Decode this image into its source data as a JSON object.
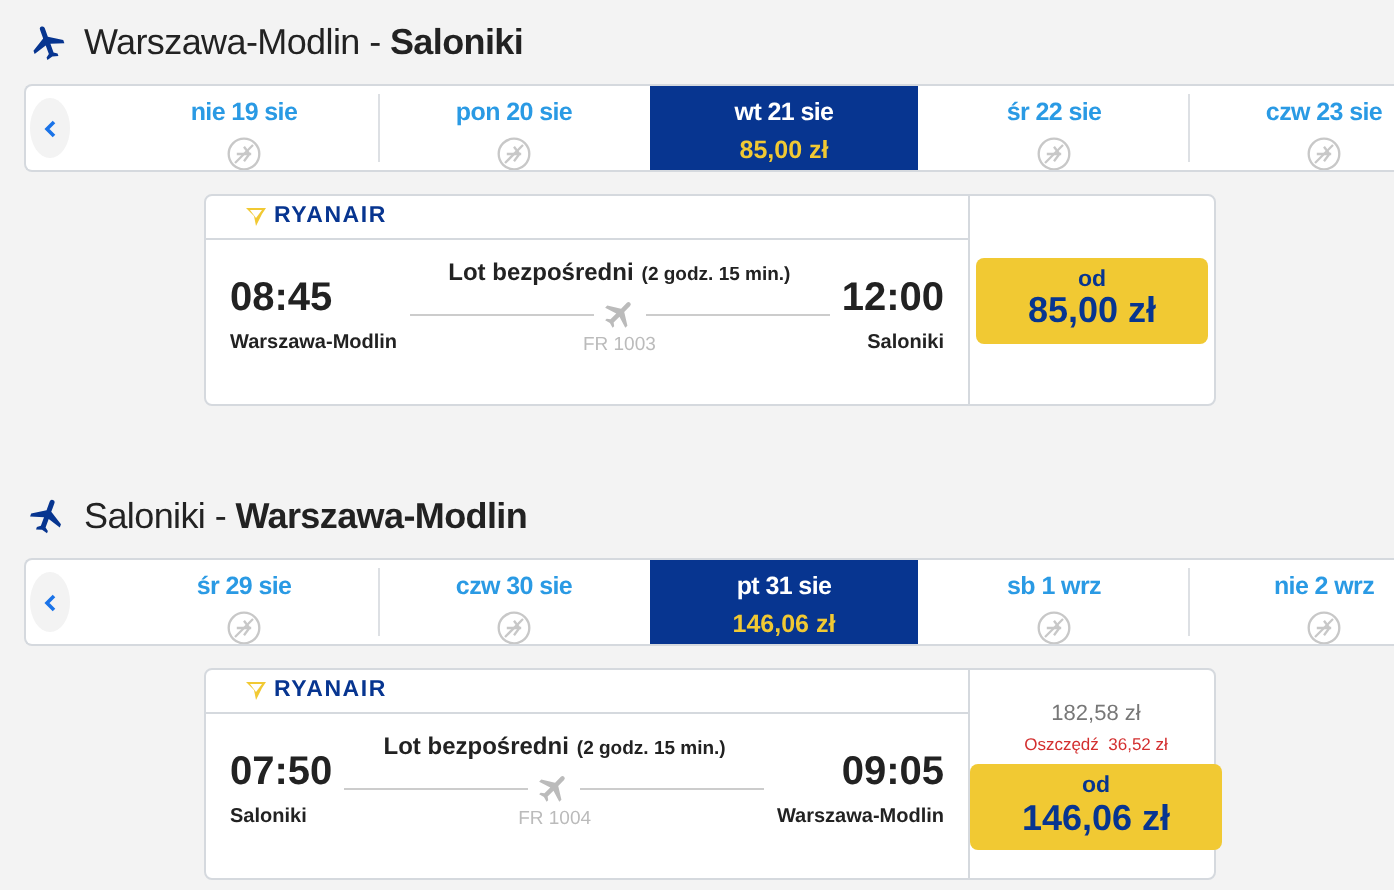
{
  "sections": [
    {
      "title": "Warszawa-Modlin - **Saloniki**",
      "days": [
        {
          "label": "nie 19 sie",
          "selected": false
        },
        {
          "label": "pon 20 sie",
          "selected": false
        },
        {
          "label": "wt 21 sie",
          "selected": true,
          "price": "85,00 zł"
        },
        {
          "label": "śr 22 sie",
          "selected": false
        },
        {
          "label": "czw 23 sie",
          "selected": false
        }
      ],
      "flight": {
        "airline": "RYANAIR",
        "type": "Lot bezpośredni",
        "duration": "(2 godz. 15 min.)",
        "depart_time": "08:45",
        "arrive_time": "12:00",
        "number": "FR 1003",
        "from": "Warszawa-Modlin",
        "to": "Saloniki",
        "price_prefix": "od",
        "price": "85,00 zł"
      }
    },
    {
      "title": "Saloniki - **Warszawa-Modlin**",
      "days": [
        {
          "label": "śr 29 sie",
          "selected": false
        },
        {
          "label": "czw 30 sie",
          "selected": false
        },
        {
          "label": "pt 31 sie",
          "selected": true,
          "price": "146,06 zł"
        },
        {
          "label": "sb 1 wrz",
          "selected": false
        },
        {
          "label": "nie 2 wrz",
          "selected": false
        }
      ],
      "flight": {
        "airline": "RYANAIR",
        "type": "Lot bezpośredni",
        "duration": "(2 godz. 15 min.)",
        "depart_time": "07:50",
        "arrive_time": "09:05",
        "number": "FR 1004",
        "from": "Saloniki",
        "to": "Warszawa-Modlin",
        "old_price": "182,58 zł",
        "saving": "Oszczędź  36,52 zł",
        "price_prefix": "od",
        "price": "146,06 zł"
      }
    }
  ]
}
